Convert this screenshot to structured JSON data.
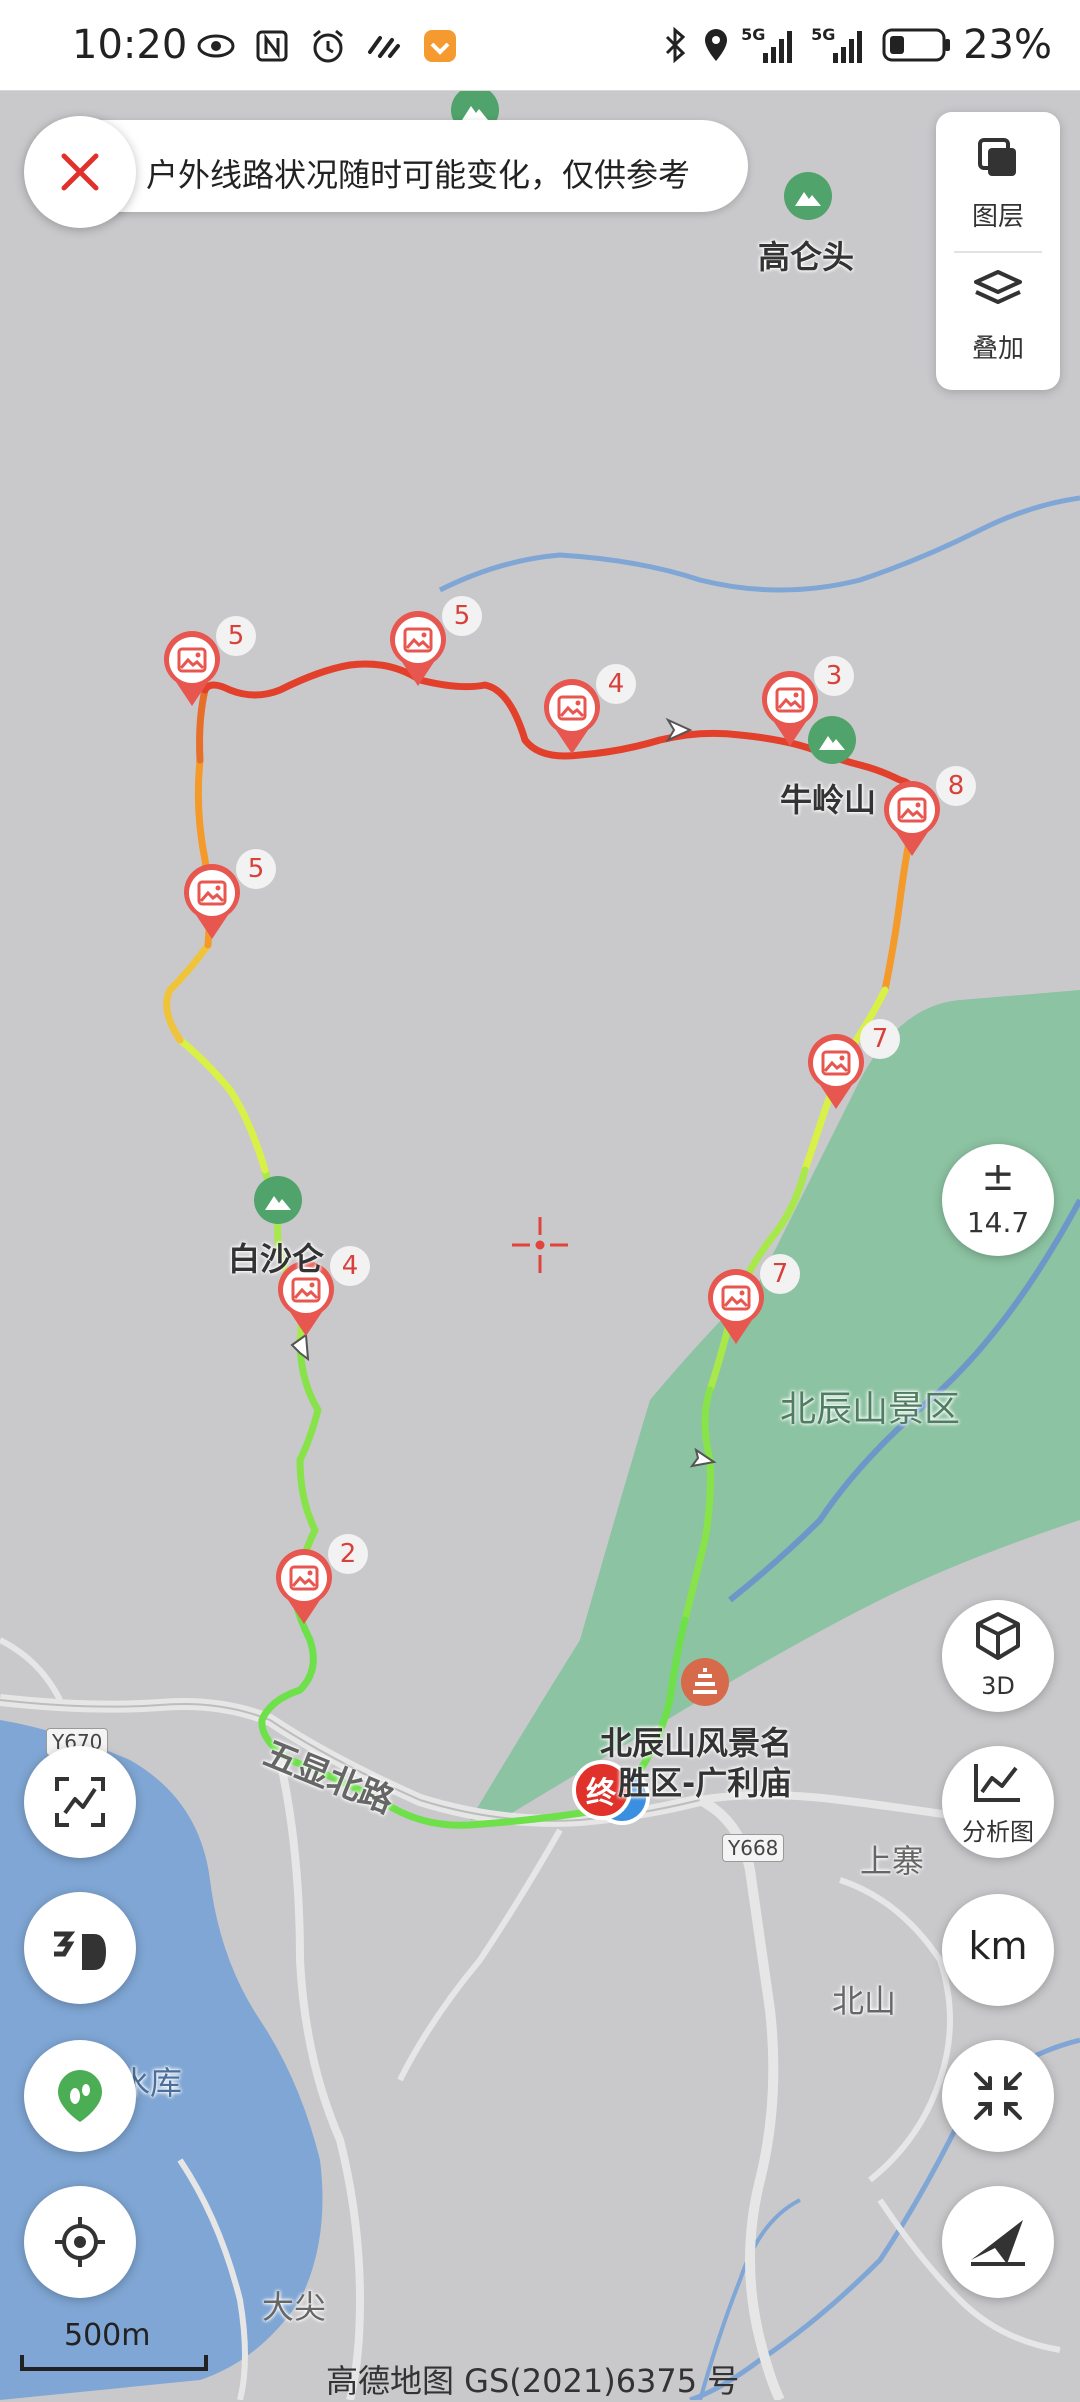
{
  "status_bar": {
    "time": "10:20",
    "battery_percent": "23%",
    "signal_1": "5G",
    "signal_2": "5G",
    "icons_left": [
      "eye-icon",
      "nfc-icon",
      "alarm-icon",
      "swipe-icon",
      "app-badge-icon"
    ],
    "icons_right": [
      "bluetooth-icon",
      "location-icon",
      "signal-5g-icon",
      "signal-5g-icon",
      "battery-icon"
    ]
  },
  "notice": {
    "text": "户外线路状况随时可能变化，仅供参考"
  },
  "layer_panel": {
    "layers_label": "图层",
    "overlay_label": "叠加"
  },
  "zoom": {
    "symbol": "±",
    "level": "14.7"
  },
  "right_buttons": {
    "three_d_label": "3D",
    "analysis_label": "分析图",
    "unit_label": "km"
  },
  "left_buttons": [
    "route-view-icon",
    "3d-terrain-icon",
    "footprint-icon",
    "locate-icon"
  ],
  "map_labels": {
    "gaolun": "高仑头",
    "niuling": "牛岭山",
    "baisha": "白沙仑",
    "beichen_area": "北辰山景区",
    "beichen_poi_1": "北辰山风景名",
    "beichen_poi_2": "胜区-广利庙",
    "road_wuxian": "五显北路",
    "shangzhai": "上寨",
    "beishan": "北山",
    "dajian": "大尖",
    "reservoir": "任水库"
  },
  "road_tags": {
    "y670": "Y670",
    "y668": "Y668"
  },
  "end_marker": "终",
  "photo_markers": [
    {
      "count": "5"
    },
    {
      "count": "5"
    },
    {
      "count": "4"
    },
    {
      "count": "3"
    },
    {
      "count": "8"
    },
    {
      "count": "5"
    },
    {
      "count": "7"
    },
    {
      "count": "4"
    },
    {
      "count": "7"
    },
    {
      "count": "2"
    }
  ],
  "scale": "500m",
  "copyright": "高德地图 GS(2021)6375 号",
  "colors": {
    "green_area": "#8cc3a2",
    "water": "#7fa6d4",
    "track_red": "#e2402a",
    "track_orange": "#f39a2a",
    "track_yellow": "#d9f046",
    "track_green": "#6ee04a",
    "marker_red": "#e8574f",
    "close_red": "#e0312a"
  }
}
